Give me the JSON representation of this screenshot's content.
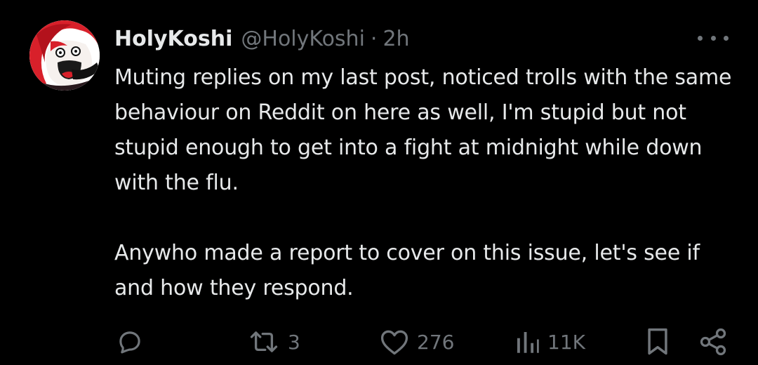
{
  "post": {
    "display_name": "HolyKoshi",
    "handle": "@HolyKoshi",
    "separator": "·",
    "time": "2h",
    "paragraphs": [
      "Muting replies on my last post, noticed trolls with the same behaviour on Reddit on here as well, I'm stupid but not stupid enough to get into a fight at midnight while down with the flu.",
      "Anywho made a report to cover on this issue, let's see if and how they respond."
    ]
  },
  "actions": {
    "reply": {
      "icon": "reply-icon",
      "count": ""
    },
    "repost": {
      "icon": "repost-icon",
      "count": "3"
    },
    "like": {
      "icon": "heart-icon",
      "count": "276"
    },
    "views": {
      "icon": "views-icon",
      "count": "11K"
    },
    "bookmark": {
      "icon": "bookmark-icon"
    },
    "share": {
      "icon": "share-icon"
    }
  },
  "colors": {
    "background": "#000000",
    "text_primary": "#e7e9ea",
    "text_secondary": "#71767b",
    "avatar_accent": "#d8202a"
  }
}
